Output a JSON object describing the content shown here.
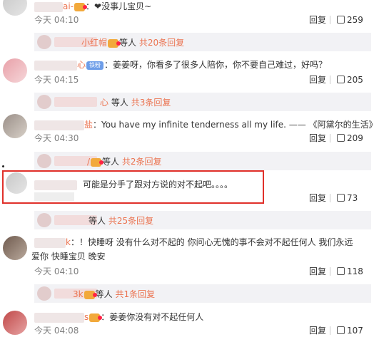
{
  "comments": [
    {
      "user_suffix": "ai-",
      "text": "：❤没事儿宝贝~",
      "time": "今天 04:10",
      "reply": "回复",
      "likes": "259"
    },
    {
      "user_suffix": "心",
      "text": "：姜姜呀，你看多了很多人陪你，你不要自己难过，好吗？",
      "time": "今天 04:15",
      "reply": "回复",
      "likes": "205",
      "tag": "铁粉"
    },
    {
      "user_suffix": "盐",
      "text": "：You have my infinite tenderness all my life. —— 《阿黛尔的生活》",
      "time": "今天 04:30",
      "reply": "回复",
      "likes": "209"
    },
    {
      "user_suffix": "",
      "text": "可能是分手了跟对方说的对不起吧。。。。",
      "time": "今天 04:10",
      "reply": "回复",
      "likes": "73"
    },
    {
      "user_suffix": "k",
      "text": "：！快睡呀 没有什么对不起的 你问心无愧的事不会对不起任何人 我们永远",
      "text2": "爱你 快睡宝贝 晚安",
      "time": "今天 04:10",
      "reply": "回复",
      "likes": "118"
    },
    {
      "user_suffix": "s",
      "text": "：姜姜你没有对不起任何人",
      "time": "今天 04:08",
      "reply": "回复",
      "likes": "107"
    }
  ],
  "sub_replies": [
    {
      "name_tail": "小红帽",
      "text": "等人",
      "count_text": "共20条回复"
    },
    {
      "name_tail": "心",
      "text": "等人",
      "count_text": "共3条回复"
    },
    {
      "name_tail": "/",
      "text": "等人",
      "count_text": "共2条回复"
    },
    {
      "name_tail": "",
      "text": "等人",
      "count_text": "共25条回复"
    },
    {
      "name_tail": "3k",
      "text": "等人",
      "count_text": "共1条回复"
    }
  ]
}
